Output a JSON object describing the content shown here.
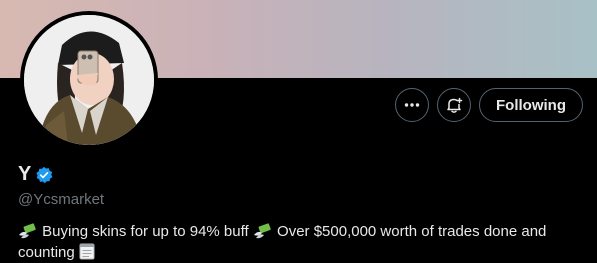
{
  "profile": {
    "display_name": "Y",
    "handle": "@Ycsmarket",
    "bio_part1": "Buying skins for up to 94% buff",
    "bio_part2": "Over $500,000 worth of trades done and counting",
    "verified": true
  },
  "actions": {
    "more_icon": "ellipsis-icon",
    "notify_icon": "bell-plus-icon",
    "follow_label": "Following"
  },
  "colors": {
    "accent_verified": "#1d9bf0",
    "background": "#000000",
    "text_primary": "#e7e9ea",
    "text_secondary": "#71767b"
  },
  "emojis": {
    "money": "money-with-wings-icon",
    "memo": "spiral-notepad-icon"
  }
}
